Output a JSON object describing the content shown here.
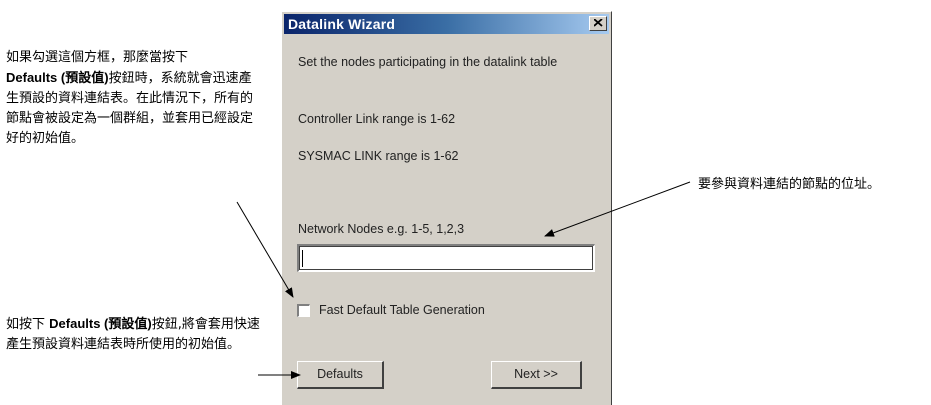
{
  "annotations": {
    "top_note_bold": "Defaults (預設值)",
    "top_note_pre": "如果勾選這個方框，那麼當按下",
    "top_note_post": "按鈕時，系統就會迅速產生預設的資料連結表。在此情況下，所有的節點會被設定為一個群組，並套用已經設定好的初始值。",
    "bottom_note_pre": "如按下 ",
    "bottom_note_bold": "Defaults (預設值)",
    "bottom_note_post": "按鈕,將會套用快速產生預設資料連結表時所使用的初始值。",
    "right_note": "要參與資料連結的節點的位址。"
  },
  "dialog": {
    "title": "Datalink Wizard",
    "instruction": "Set the nodes participating in the datalink table",
    "controller_range": "Controller Link range is 1-62",
    "sysmac_range": "SYSMAC LINK range is 1-62",
    "nodes_label": "Network Nodes  e.g. 1-5, 1,2,3",
    "nodes_value": "",
    "fast_checkbox_label": "Fast Default Table Generation",
    "fast_checkbox_checked": false,
    "defaults_button": "Defaults",
    "next_button": "Next   >>"
  },
  "colors": {
    "dialog_bg": "#d4d0c8",
    "titlebar_start": "#0a246a",
    "titlebar_end": "#a6caf0"
  },
  "icons": {
    "close": "close-icon"
  }
}
